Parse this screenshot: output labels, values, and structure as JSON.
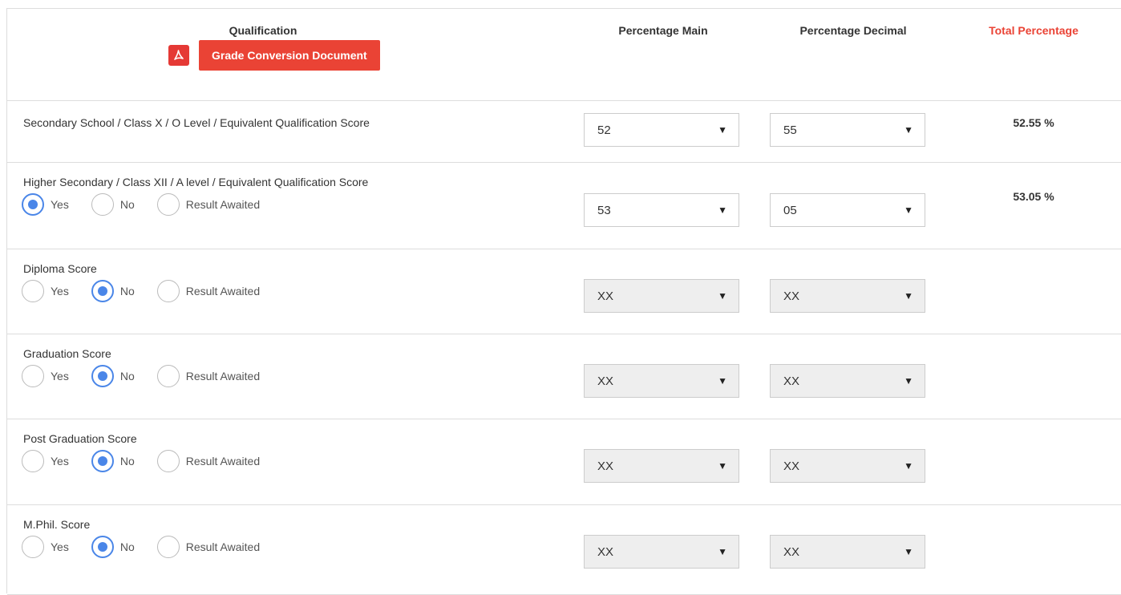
{
  "header": {
    "qualification": "Qualification",
    "doc_button": "Grade Conversion Document",
    "percentage_main": "Percentage Main",
    "percentage_decimal": "Percentage Decimal",
    "total_percentage": "Total Percentage"
  },
  "radio_labels": {
    "yes": "Yes",
    "no": "No",
    "awaited": "Result Awaited"
  },
  "rows": [
    {
      "label": "Secondary School / Class X / O Level / Equivalent Qualification Score",
      "main": "52",
      "decimal": "55",
      "total": "52.55 %",
      "selected": null
    },
    {
      "label": "Higher Secondary / Class XII / A level / Equivalent Qualification Score",
      "main": "53",
      "decimal": "05",
      "total": "53.05 %",
      "selected": "yes"
    },
    {
      "label": "Diploma Score",
      "main": "XX",
      "decimal": "XX",
      "total": "",
      "selected": "no"
    },
    {
      "label": "Graduation Score",
      "main": "XX",
      "decimal": "XX",
      "total": "",
      "selected": "no"
    },
    {
      "label": "Post Graduation Score",
      "main": "XX",
      "decimal": "XX",
      "total": "",
      "selected": "no"
    },
    {
      "label": "M.Phil. Score",
      "main": "XX",
      "decimal": "XX",
      "total": "",
      "selected": "no"
    }
  ],
  "colors": {
    "accent": "#4a86e8",
    "brand_red": "#ea4335"
  },
  "icons": {
    "pdf": "pdf-icon",
    "dropdown": "chevron-down-icon"
  }
}
